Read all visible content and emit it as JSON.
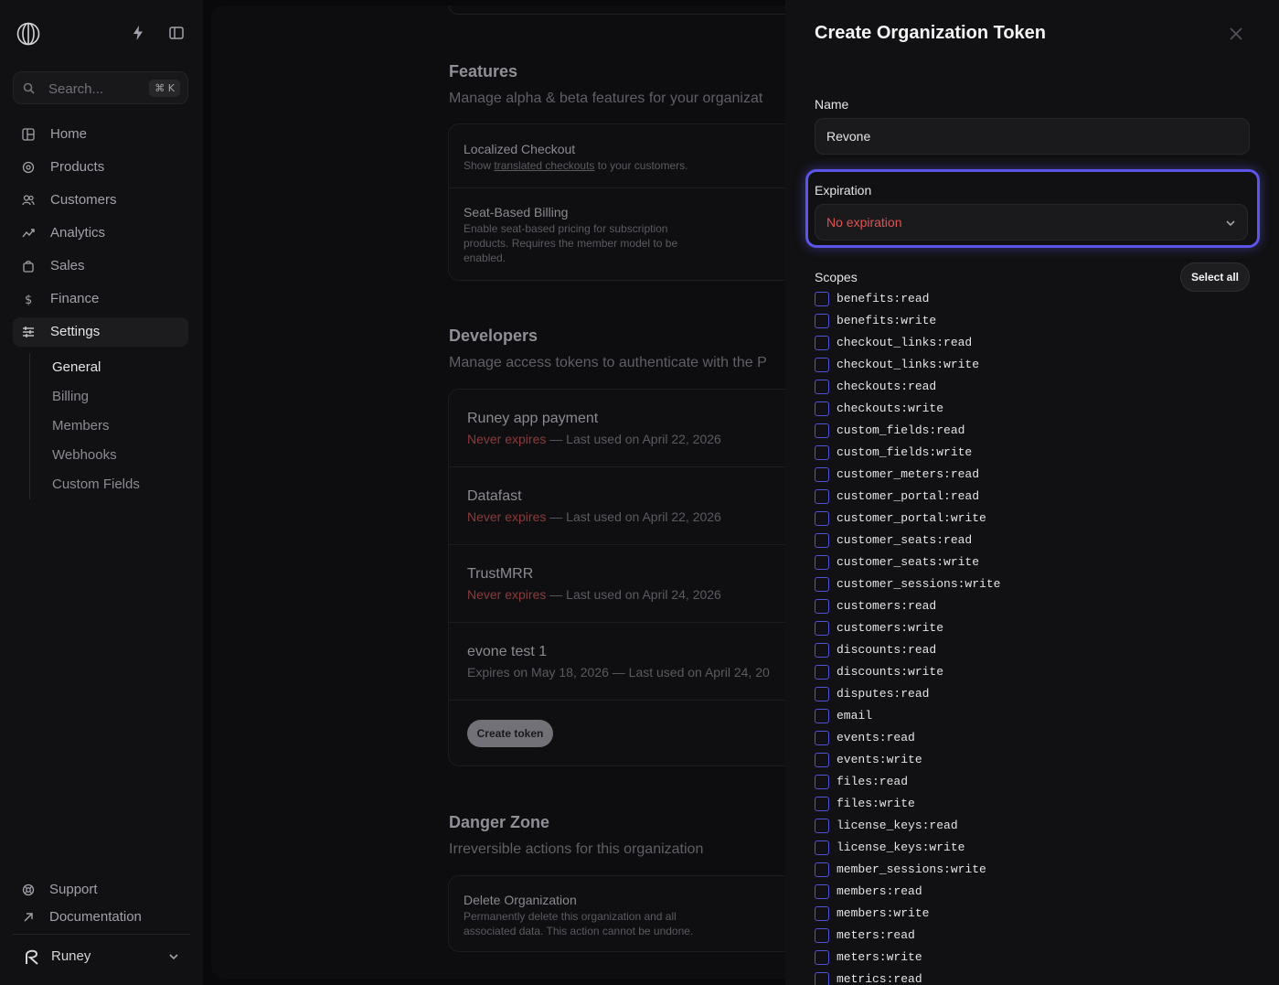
{
  "sidebar": {
    "search": {
      "placeholder": "Search...",
      "shortcut": "⌘ K"
    },
    "nav": [
      {
        "label": "Home",
        "icon": "home-icon"
      },
      {
        "label": "Products",
        "icon": "products-icon"
      },
      {
        "label": "Customers",
        "icon": "customers-icon"
      },
      {
        "label": "Analytics",
        "icon": "analytics-icon"
      },
      {
        "label": "Sales",
        "icon": "sales-icon"
      },
      {
        "label": "Finance",
        "icon": "finance-icon"
      },
      {
        "label": "Settings",
        "icon": "settings-icon"
      }
    ],
    "settings_sub": [
      "General",
      "Billing",
      "Members",
      "Webhooks",
      "Custom Fields"
    ],
    "footer": [
      {
        "label": "Support",
        "icon": "support-icon"
      },
      {
        "label": "Documentation",
        "icon": "external-link-icon"
      }
    ],
    "user": {
      "name": "Runey"
    }
  },
  "main": {
    "features": {
      "title": "Features",
      "subtitle": "Manage alpha & beta features for your organizat",
      "items": [
        {
          "title": "Localized Checkout",
          "desc_pre": "Show ",
          "desc_link": "translated checkouts",
          "desc_post": " to your customers."
        },
        {
          "title": "Seat-Based Billing",
          "desc": "Enable seat-based pricing for subscription products. Requires the member model to be enabled."
        }
      ]
    },
    "developers": {
      "title": "Developers",
      "subtitle": "Manage access tokens to authenticate with the P",
      "tokens": [
        {
          "name": "Runey app payment",
          "expiry": "Never expires",
          "last_used": " — Last used on April 22, 2026"
        },
        {
          "name": "Datafast",
          "expiry": "Never expires",
          "last_used": " — Last used on April 22, 2026"
        },
        {
          "name": "TrustMRR",
          "expiry": "Never expires",
          "last_used": " — Last used on April 24, 2026"
        },
        {
          "name": "evone test 1",
          "expiry": "Expires on May 18, 2026",
          "last_used": " — Last used on April 24, 20"
        }
      ],
      "create_label": "Create token"
    },
    "danger": {
      "title": "Danger Zone",
      "subtitle": "Irreversible actions for this organization",
      "item_title": "Delete Organization",
      "item_desc": "Permanently delete this organization and all associated data. This action cannot be undone."
    }
  },
  "modal": {
    "title": "Create Organization Token",
    "name_label": "Name",
    "name_value": "Revone",
    "expiration_label": "Expiration",
    "expiration_value": "No expiration",
    "scopes_label": "Scopes",
    "select_all_label": "Select all",
    "scopes": [
      "benefits:read",
      "benefits:write",
      "checkout_links:read",
      "checkout_links:write",
      "checkouts:read",
      "checkouts:write",
      "custom_fields:read",
      "custom_fields:write",
      "customer_meters:read",
      "customer_portal:read",
      "customer_portal:write",
      "customer_seats:read",
      "customer_seats:write",
      "customer_sessions:write",
      "customers:read",
      "customers:write",
      "discounts:read",
      "discounts:write",
      "disputes:read",
      "email",
      "events:read",
      "events:write",
      "files:read",
      "files:write",
      "license_keys:read",
      "license_keys:write",
      "member_sessions:write",
      "members:read",
      "members:write",
      "meters:read",
      "meters:write",
      "metrics:read"
    ]
  },
  "colors": {
    "accent": "#5b55e8",
    "danger": "#e05252",
    "checkbox": "#4f52d4"
  }
}
